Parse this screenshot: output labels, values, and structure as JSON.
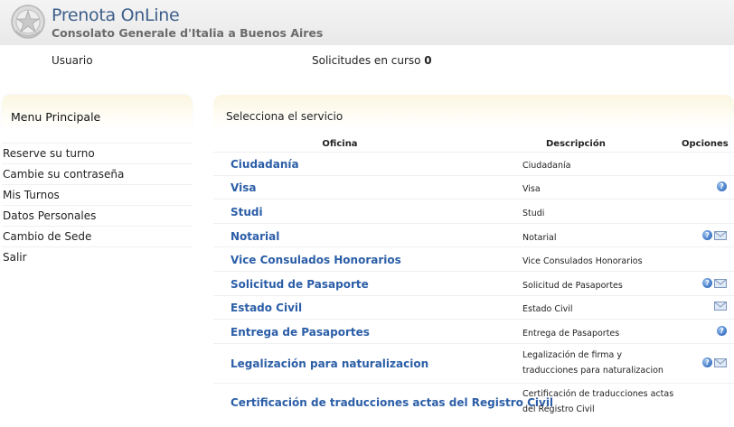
{
  "header": {
    "title": "Prenota OnLine",
    "subtitle": "Consolato Generale d'Italia a Buenos Aires",
    "logo_icon": "italian-emblem-icon"
  },
  "userbar": {
    "user_label": "Usuario",
    "requests_label": "Solicitudes en curso",
    "requests_count": "0"
  },
  "sidebar": {
    "title": "Menu Principale",
    "items": [
      {
        "label": "Reserve su turno"
      },
      {
        "label": "Cambie su contraseña"
      },
      {
        "label": "Mis Turnos"
      },
      {
        "label": "Datos Personales"
      },
      {
        "label": "Cambio de Sede"
      },
      {
        "label": "Salir"
      }
    ]
  },
  "main": {
    "title": "Selecciona el servicio",
    "columns": {
      "office": "Oficina",
      "description": "Descripción",
      "options": "Opciones"
    },
    "rows": [
      {
        "office": "Ciudadanía",
        "description": "Ciudadanía",
        "info": false,
        "mail": false
      },
      {
        "office": "Visa",
        "description": "Visa",
        "info": true,
        "mail": false
      },
      {
        "office": "Studi",
        "description": "Studi",
        "info": false,
        "mail": false
      },
      {
        "office": "Notarial",
        "description": "Notarial",
        "info": true,
        "mail": true
      },
      {
        "office": "Vice Consulados Honorarios",
        "description": "Vice Consulados Honorarios",
        "info": false,
        "mail": false
      },
      {
        "office": "Solicitud de Pasaporte",
        "description": "Solicitud de Pasaportes",
        "info": true,
        "mail": true
      },
      {
        "office": "Estado Civil",
        "description": "Estado Civil",
        "info": false,
        "mail": true
      },
      {
        "office": "Entrega de Pasaportes",
        "description": "Entrega de Pasaportes",
        "info": true,
        "mail": false
      },
      {
        "office": "Legalización para naturalizacion",
        "description": "Legalización de firma y traducciones para naturalizacion",
        "info": true,
        "mail": true
      },
      {
        "office": "Certificación de traducciones actas del Registro Civil",
        "description": "Certificación de traducciones actas del Registro Civil",
        "info": false,
        "mail": false
      }
    ],
    "info_icon": "question-icon",
    "mail_icon": "envelope-icon"
  },
  "colors": {
    "link": "#2b5ea7",
    "title": "#3e5f8a",
    "panel_head": "#fbf6e0",
    "info_icon": "#3c74c4"
  }
}
